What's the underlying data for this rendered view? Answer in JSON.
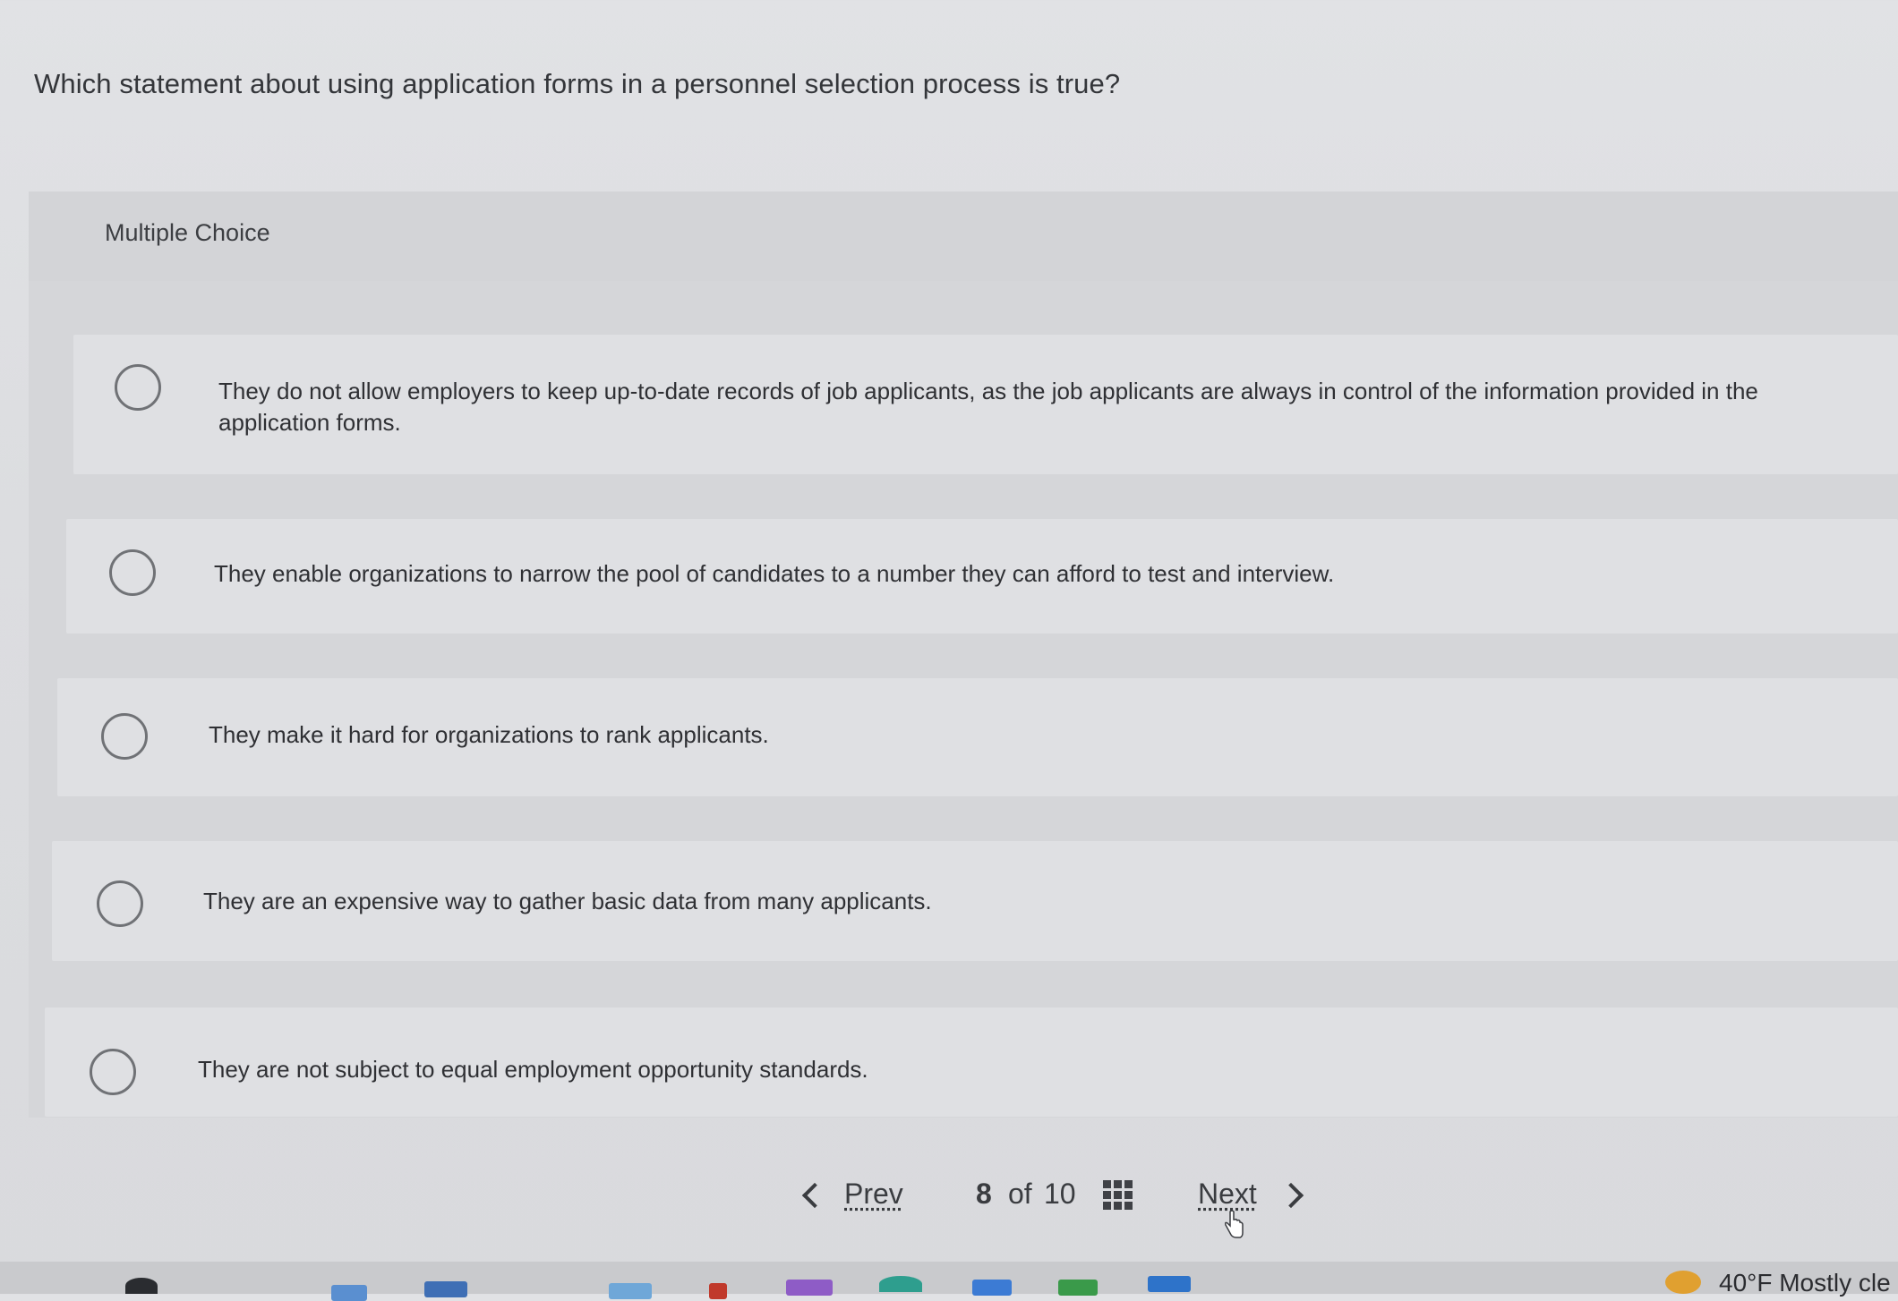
{
  "question": {
    "text": "Which statement about using application forms in a personnel selection process is true?"
  },
  "multiple_choice": {
    "label": "Multiple Choice",
    "options": [
      {
        "text": "They do not allow employers to keep up-to-date records of job applicants, as the job applicants are always in control of the information provided in the application forms."
      },
      {
        "text": "They enable organizations to narrow the pool of candidates to a number they can afford to test and interview."
      },
      {
        "text": "They make it hard for organizations to rank applicants."
      },
      {
        "text": "They are an expensive way to gather basic data from many applicants."
      },
      {
        "text": "They are not subject to equal employment opportunity standards."
      }
    ]
  },
  "navigation": {
    "prev_label": "Prev",
    "current": "8",
    "of_label": "of",
    "total": "10",
    "next_label": "Next"
  },
  "taskbar": {
    "weather_text": "40°F Mostly cle"
  }
}
